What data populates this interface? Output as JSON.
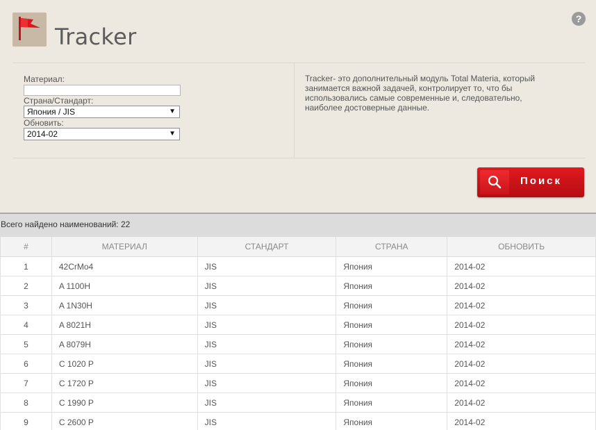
{
  "app": {
    "title": "Tracker",
    "help_label": "?"
  },
  "form": {
    "material_label": "Материал:",
    "material_value": "",
    "country_label": "Страна/Стандарт:",
    "country_value": "Япония / JIS",
    "update_label": "Обновить:",
    "update_value": "2014-02"
  },
  "description": "Tracker- это дополнительный модуль Total Materia, который занимается важной задачей, контролирует то, что бы использовались самые современные и, следовательно, наиболее достоверные данные.",
  "search_button": {
    "label": "Поиск"
  },
  "results": {
    "count_text": "Всего найдено наименований: 22",
    "columns": [
      "#",
      "МАТЕРИАЛ",
      "СТАНДАРТ",
      "СТРАНА",
      "ОБНОВИТЬ"
    ],
    "rows": [
      [
        "1",
        "42CrMo4",
        "JIS",
        "Япония",
        "2014-02"
      ],
      [
        "2",
        "A 1100H",
        "JIS",
        "Япония",
        "2014-02"
      ],
      [
        "3",
        "A 1N30H",
        "JIS",
        "Япония",
        "2014-02"
      ],
      [
        "4",
        "A 8021H",
        "JIS",
        "Япония",
        "2014-02"
      ],
      [
        "5",
        "A 8079H",
        "JIS",
        "Япония",
        "2014-02"
      ],
      [
        "6",
        "C 1020 P",
        "JIS",
        "Япония",
        "2014-02"
      ],
      [
        "7",
        "C 1720 P",
        "JIS",
        "Япония",
        "2014-02"
      ],
      [
        "8",
        "C 1990 P",
        "JIS",
        "Япония",
        "2014-02"
      ],
      [
        "9",
        "C 2600 P",
        "JIS",
        "Япония",
        "2014-02"
      ]
    ]
  },
  "colors": {
    "accent": "#d4171c",
    "panel_bg": "#ede9e1",
    "logo_bg": "#c7b9a5"
  },
  "icons": {
    "logo": "flag-icon",
    "search": "search-icon",
    "help": "help-icon"
  }
}
